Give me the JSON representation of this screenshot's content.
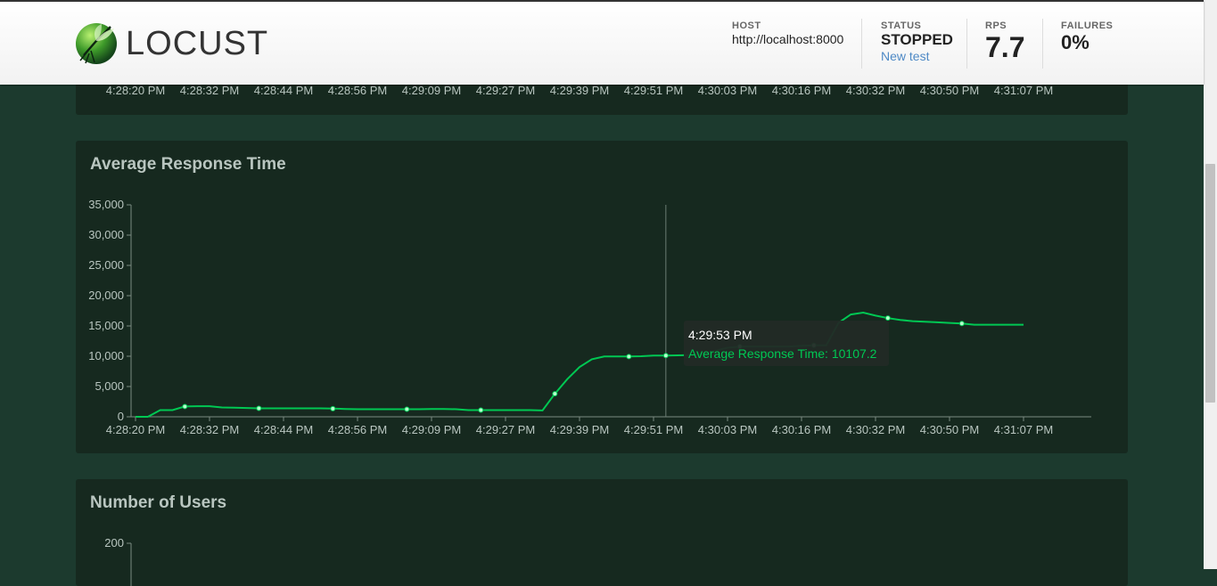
{
  "header": {
    "logo_text": "LOCUST",
    "host_label": "HOST",
    "host_value": "http://localhost:8000",
    "status_label": "STATUS",
    "status_value": "STOPPED",
    "new_test_label": "New test",
    "rps_label": "RPS",
    "rps_value": "7.7",
    "failures_label": "FAILURES",
    "failures_value": "0%"
  },
  "colors": {
    "line": "#00c853",
    "panel": "#16291f",
    "background": "#1c3a2e"
  },
  "top_axis_ticks": [
    "4:28:20 PM",
    "4:28:32 PM",
    "4:28:44 PM",
    "4:28:56 PM",
    "4:29:09 PM",
    "4:29:27 PM",
    "4:29:39 PM",
    "4:29:51 PM",
    "4:30:03 PM",
    "4:30:16 PM",
    "4:30:32 PM",
    "4:30:50 PM",
    "4:31:07 PM"
  ],
  "response_panel": {
    "title": "Average Response Time"
  },
  "users_panel": {
    "title": "Number of Users"
  },
  "tooltip": {
    "time": "4:29:53 PM",
    "text": "Average Response Time: 10107.2"
  },
  "chart_data": [
    {
      "type": "line",
      "title": "Average Response Time",
      "ylim": [
        0,
        35000
      ],
      "yticks": [
        "0",
        "5,000",
        "10,000",
        "15,000",
        "20,000",
        "25,000",
        "30,000",
        "35,000"
      ],
      "ytick_values": [
        0,
        5000,
        10000,
        15000,
        20000,
        25000,
        30000,
        35000
      ],
      "xticks": [
        "4:28:20 PM",
        "4:28:32 PM",
        "4:28:44 PM",
        "4:28:56 PM",
        "4:29:09 PM",
        "4:29:27 PM",
        "4:29:39 PM",
        "4:29:51 PM",
        "4:30:03 PM",
        "4:30:16 PM",
        "4:30:32 PM",
        "4:30:50 PM",
        "4:31:07 PM"
      ],
      "series": [
        {
          "name": "Average Response Time",
          "values": [
            0,
            0,
            1100,
            1100,
            1700,
            1750,
            1750,
            1550,
            1500,
            1450,
            1400,
            1400,
            1400,
            1400,
            1400,
            1400,
            1350,
            1300,
            1250,
            1250,
            1250,
            1250,
            1250,
            1250,
            1300,
            1300,
            1250,
            1100,
            1100,
            1100,
            1100,
            1100,
            1100,
            1050,
            3800,
            6200,
            8200,
            9500,
            9950,
            9950,
            9950,
            10000,
            10100,
            10107.2,
            10150,
            10200,
            10400,
            10900,
            11400,
            11600,
            11600,
            11600,
            11600,
            11600,
            11700,
            11800,
            11800,
            15500,
            16900,
            17200,
            16700,
            16300,
            16000,
            15800,
            15700,
            15600,
            15500,
            15400,
            15200,
            15200,
            15200,
            15200,
            15200
          ]
        }
      ],
      "markers": [
        4,
        10,
        16,
        22,
        28,
        34,
        40,
        43,
        49,
        55,
        61,
        67
      ]
    },
    {
      "type": "line",
      "title": "Number of Users",
      "yticks": [
        "200"
      ],
      "ytick_values": [
        200
      ]
    }
  ]
}
